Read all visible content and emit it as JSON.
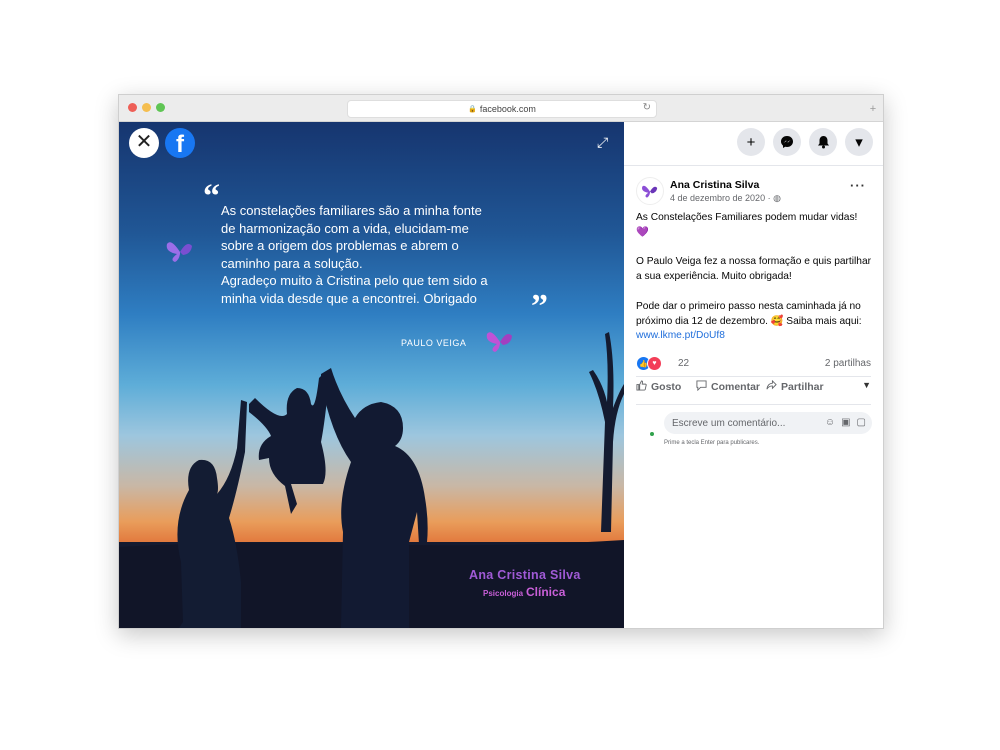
{
  "browser": {
    "url": "facebook.com",
    "lock_icon": "lock-icon",
    "reload_icon": "reload-icon"
  },
  "viewer": {
    "close_icon": "close-icon",
    "logo_letter": "f",
    "expand_icon": "expand-icon",
    "quote_open": "“",
    "quote_close": "”",
    "quote_lines": [
      "As constelações familiares são a minha fonte",
      "de harmonização com a vida, elucidam-me",
      "sobre a origem dos problemas e abrem o",
      "caminho para a solução.",
      "Agradeço muito à Cristina pelo que tem sido a",
      "minha vida desde que a encontrei. Obrigado"
    ],
    "author": "PAULO VEIGA",
    "signature_name": "Ana Cristina Silva",
    "signature_sub": "Psicologia",
    "signature_sub_bold": "Clínica"
  },
  "header_icons": [
    "plus-icon",
    "messenger-icon",
    "bell-icon",
    "caret-down-icon"
  ],
  "post": {
    "author": "Ana Cristina Silva",
    "date": "4 de dezembro de 2020 ·",
    "privacy_icon": "globe-icon",
    "more": "···",
    "para1": "As Constelações Familiares podem mudar vidas! 💜",
    "para2": "O Paulo Veiga fez a nossa formação e quis partilhar a sua experiência. Muito obrigada!",
    "para3": "Pode dar o primeiro passo nesta caminhada já no próximo dia 12 de dezembro. 🥰 Saiba mais aqui:",
    "link": "www.lkme.pt/DoUf8",
    "reaction_count": "22",
    "shares": "2 partilhas",
    "actions": {
      "like": "Gosto",
      "comment": "Comentar",
      "share": "Partilhar"
    },
    "comment_placeholder": "Escreve um comentário...",
    "comment_hint": "Prime a tecla Enter para publicares."
  }
}
